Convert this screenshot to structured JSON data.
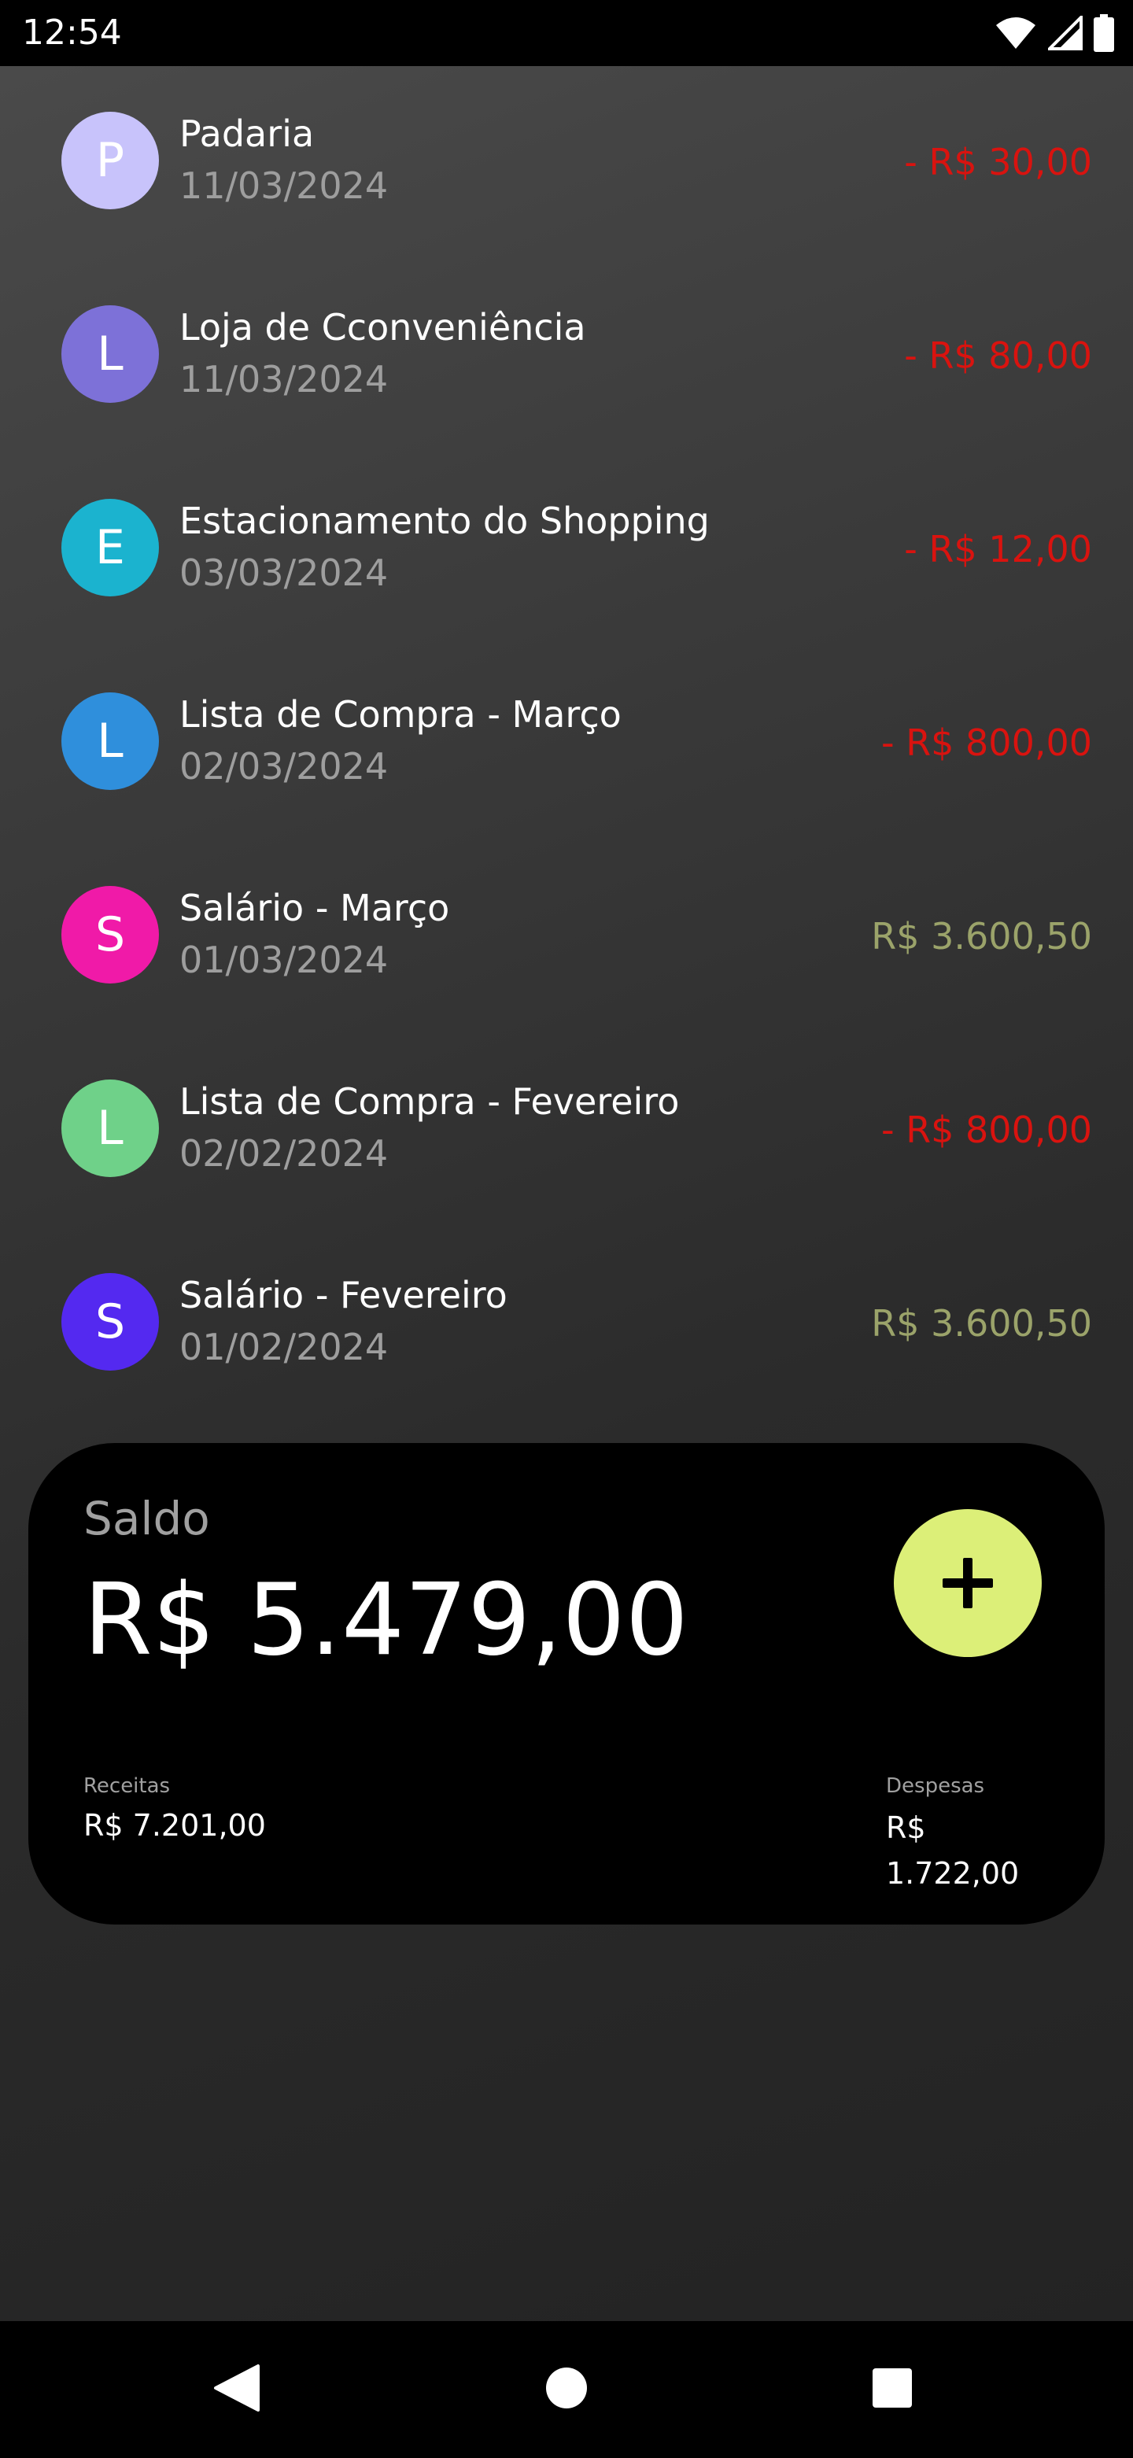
{
  "status_bar": {
    "time": "12:54",
    "icons": [
      "wifi-icon",
      "signal-icon",
      "battery-icon"
    ]
  },
  "transactions": [
    {
      "initial": "P",
      "name": "Padaria",
      "date": "11/03/2024",
      "amount": "- R$ 30,00",
      "type": "expense",
      "avatar_color": "#c8c3fb"
    },
    {
      "initial": "L",
      "name": "Loja de Cconveniência",
      "date": "11/03/2024",
      "amount": "- R$ 80,00",
      "type": "expense",
      "avatar_color": "#7d71d8"
    },
    {
      "initial": "E",
      "name": "Estacionamento do Shopping",
      "date": "03/03/2024",
      "amount": "- R$ 12,00",
      "type": "expense",
      "avatar_color": "#1bb3cf"
    },
    {
      "initial": "L",
      "name": "Lista de Compra - Março",
      "date": "02/03/2024",
      "amount": "- R$ 800,00",
      "type": "expense",
      "avatar_color": "#2f8fdc"
    },
    {
      "initial": "S",
      "name": "Salário - Março",
      "date": "01/03/2024",
      "amount": "R$ 3.600,50",
      "type": "income",
      "avatar_color": "#f01aa8"
    },
    {
      "initial": "L",
      "name": "Lista de Compra - Fevereiro",
      "date": "02/02/2024",
      "amount": "- R$ 800,00",
      "type": "expense",
      "avatar_color": "#6fd189"
    },
    {
      "initial": "S",
      "name": "Salário - Fevereiro",
      "date": "01/02/2024",
      "amount": "R$ 3.600,50",
      "type": "income",
      "avatar_color": "#5429f0"
    }
  ],
  "colors": {
    "expense": "#d9130f",
    "income": "#9ba36a",
    "accent": "#dcef78"
  },
  "summary": {
    "saldo_label": "Saldo",
    "saldo_value": "R$ 5.479,00",
    "add_icon": "plus-icon",
    "receitas_label": "Receitas",
    "receitas_value": "R$ 7.201,00",
    "despesas_label": "Despesas",
    "despesas_value": "R$ 1.722,00"
  },
  "nav": {
    "icons": [
      "back-icon",
      "home-icon",
      "recents-icon"
    ]
  }
}
